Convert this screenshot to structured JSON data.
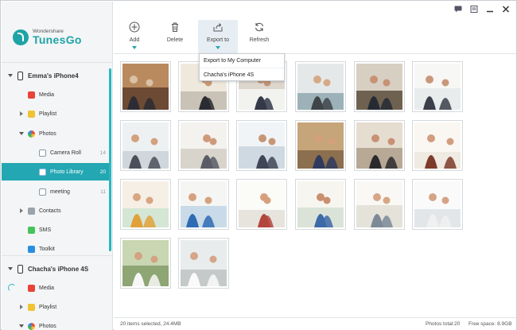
{
  "app": {
    "brand_small": "Wondershare",
    "brand_name": "TunesGo",
    "accent_color": "#23a7b3"
  },
  "window_controls": [
    {
      "name": "message-icon"
    },
    {
      "name": "feedback-icon"
    },
    {
      "name": "minimize-icon"
    },
    {
      "name": "close-icon"
    }
  ],
  "sidebar": {
    "device1": {
      "name": "Emma's iPhone4"
    },
    "device1_items": {
      "media": "Media",
      "playlist": "Playlist",
      "photos": "Photos",
      "camera_roll": "Camera Roll",
      "camera_roll_count": "14",
      "photo_library": "Photo Library",
      "photo_library_count": "20",
      "meeting": "meeting",
      "meeting_count": "11",
      "contacts": "Contacts",
      "sms": "SMS",
      "toolkit": "Toolkit"
    },
    "device2": {
      "name": "Chacha's iPhone 4S"
    },
    "device2_items": {
      "media": "Media",
      "playlist": "Playlist",
      "photos": "Photos"
    }
  },
  "toolbar": {
    "add": "Add",
    "delete": "Delete",
    "export": "Export to",
    "refresh": "Refresh"
  },
  "export_menu": {
    "item1": "Export to My Computer",
    "item2": "Chacha's iPhone 4S"
  },
  "photos": [
    {
      "scene": "meeting-room"
    },
    {
      "scene": "meeting-room"
    },
    {
      "scene": "office-group"
    },
    {
      "scene": "headset-woman"
    },
    {
      "scene": "business-team"
    },
    {
      "scene": "standing-woman"
    },
    {
      "scene": "smiling-man"
    },
    {
      "scene": "business-women"
    },
    {
      "scene": "office-walk"
    },
    {
      "scene": "classroom"
    },
    {
      "scene": "woman-corridor"
    },
    {
      "scene": "woman-laptop"
    },
    {
      "scene": "girls-laptop"
    },
    {
      "scene": "kids-laptop"
    },
    {
      "scene": "family"
    },
    {
      "scene": "family-floor"
    },
    {
      "scene": "women-laptop"
    },
    {
      "scene": "woman-laptop-floor"
    },
    {
      "scene": "wedding-couple"
    },
    {
      "scene": "wedding-bride"
    }
  ],
  "status": {
    "selected": "20 items selected, 24.4MB",
    "total": "Photos total:20",
    "free": "Free space: 8.9GB"
  }
}
